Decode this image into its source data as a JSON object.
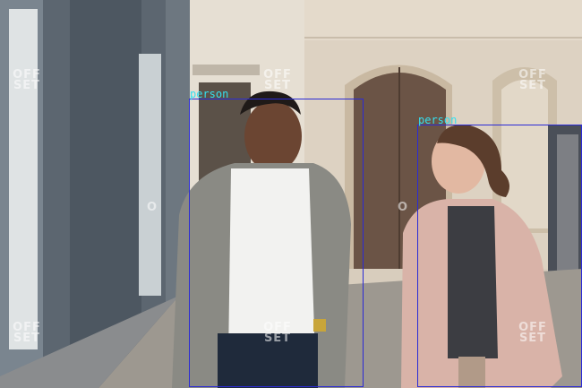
{
  "detections": [
    {
      "label": "person"
    },
    {
      "label": "person"
    }
  ],
  "watermark": {
    "line1": "OFF",
    "line2": "SET",
    "mark": "O"
  },
  "colors": {
    "box": "#2b2bd6",
    "label": "#34e0f0"
  }
}
